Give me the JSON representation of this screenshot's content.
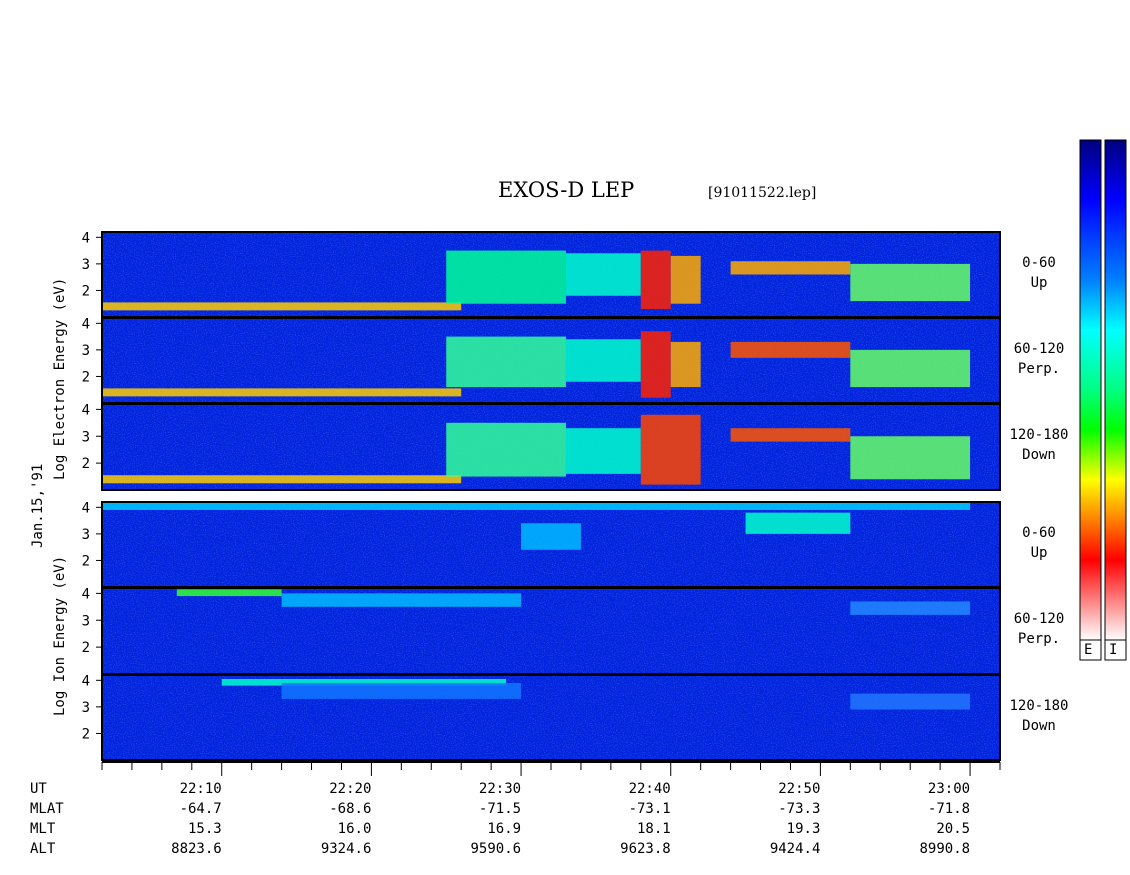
{
  "header": {
    "title": "EXOS-D LEP",
    "filename": "[91011522.lep]"
  },
  "side_labels": {
    "electron": "Log  Electron  Energy (eV)",
    "ion": "Log  Ion  Energy (eV)",
    "date": "Jan.15,'91"
  },
  "colorbar": {
    "labels": [
      "E",
      "I"
    ],
    "colors": [
      "#ffffff",
      "#ff0000",
      "#ffff00",
      "#00ff00",
      "#00ffff",
      "#0000ff",
      "#000080"
    ]
  },
  "chart_data": {
    "type": "heatmap",
    "title": "EXOS-D LEP",
    "xlabel": "UT",
    "ylabel": "Log Energy (eV)",
    "ylim": [
      1,
      4.2
    ],
    "yticks": [
      "4",
      "3",
      "2"
    ],
    "xlim_minutes": [
      "22:02",
      "23:02"
    ],
    "panels": [
      {
        "species": "Electron",
        "pitch": "0-60",
        "dir": "Up"
      },
      {
        "species": "Electron",
        "pitch": "60-120",
        "dir": "Perp."
      },
      {
        "species": "Electron",
        "pitch": "120-180",
        "dir": "Down"
      },
      {
        "species": "Ion",
        "pitch": "0-60",
        "dir": "Up"
      },
      {
        "species": "Ion",
        "pitch": "60-120",
        "dir": "Perp."
      },
      {
        "species": "Ion",
        "pitch": "120-180",
        "dir": "Down"
      }
    ],
    "ephemeris": {
      "labels": [
        "UT",
        "MLAT",
        "MLT",
        "ALT"
      ],
      "columns": [
        {
          "UT": "22:10",
          "MLAT": "-64.7",
          "MLT": "15.3",
          "ALT": "8823.6"
        },
        {
          "UT": "22:20",
          "MLAT": "-68.6",
          "MLT": "16.0",
          "ALT": "9324.6"
        },
        {
          "UT": "22:30",
          "MLAT": "-71.5",
          "MLT": "16.9",
          "ALT": "9590.6"
        },
        {
          "UT": "22:40",
          "MLAT": "-73.1",
          "MLT": "18.1",
          "ALT": "9623.8"
        },
        {
          "UT": "22:50",
          "MLAT": "-73.3",
          "MLT": "19.3",
          "ALT": "9424.4"
        },
        {
          "UT": "23:00",
          "MLAT": "-71.8",
          "MLT": "20.5",
          "ALT": "8990.8"
        }
      ]
    }
  }
}
